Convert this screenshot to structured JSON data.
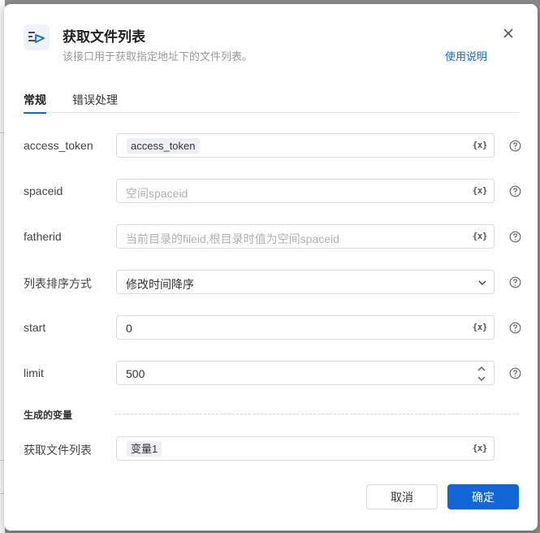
{
  "dialog": {
    "title": "获取文件列表",
    "subtitle": "该接口用于获取指定地址下的文件列表。",
    "help_link": "使用说明"
  },
  "tabs": [
    {
      "label": "常规",
      "active": true
    },
    {
      "label": "错误处理",
      "active": false
    }
  ],
  "fields": {
    "access_token": {
      "label": "access_token",
      "chip": "access_token",
      "fx": "{x}"
    },
    "spaceid": {
      "label": "spaceid",
      "placeholder": "空间spaceid",
      "fx": "{x}"
    },
    "fatherid": {
      "label": "fatherid",
      "placeholder": "当前目录的fileid,根目录时值为空间spaceid",
      "fx": "{x}"
    },
    "sort": {
      "label": "列表排序方式",
      "value": "修改时间降序"
    },
    "start": {
      "label": "start",
      "value": "0",
      "fx": "{x}"
    },
    "limit": {
      "label": "limit",
      "value": "500"
    }
  },
  "output": {
    "section_label": "生成的变量",
    "var_label": "获取文件列表",
    "var_chip": "变量1",
    "fx": "{x}"
  },
  "footer": {
    "cancel_label": "取消",
    "ok_label": "确定"
  },
  "colors": {
    "accent": "#1366d6",
    "overlay": "#8a8a8a"
  }
}
